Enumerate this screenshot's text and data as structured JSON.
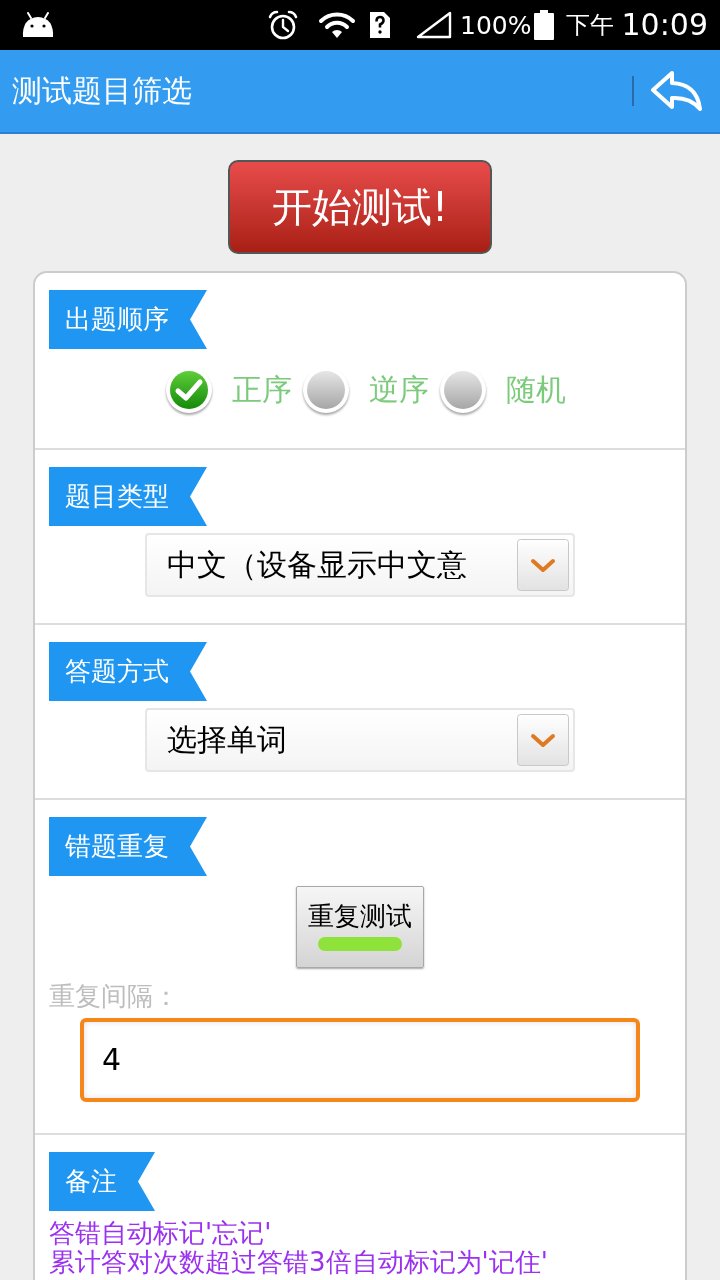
{
  "status_bar": {
    "battery": "100%",
    "time_prefix": "下午",
    "time": "10:09"
  },
  "app_bar": {
    "title": "测试题目筛选"
  },
  "start_button": {
    "label": "开始测试!"
  },
  "sections": [
    {
      "kind": "radio",
      "label": "出题顺序",
      "options": [
        {
          "label": "正序",
          "selected": true
        },
        {
          "label": "逆序",
          "selected": false
        },
        {
          "label": "随机",
          "selected": false
        }
      ]
    },
    {
      "kind": "select",
      "label": "题目类型",
      "value": "中文（设备显示中文意"
    },
    {
      "kind": "select",
      "label": "答题方式",
      "value": "选择单词"
    },
    {
      "kind": "repeat",
      "label": "错题重复",
      "toggle": {
        "label": "重复测试",
        "on": true
      },
      "field_label": "重复间隔：",
      "field_value": "4"
    },
    {
      "kind": "notes",
      "label": "备注",
      "lines": [
        "答错自动标记'忘记'",
        "累计答对次数超过答错3倍自动标记为'记住'"
      ]
    }
  ]
}
